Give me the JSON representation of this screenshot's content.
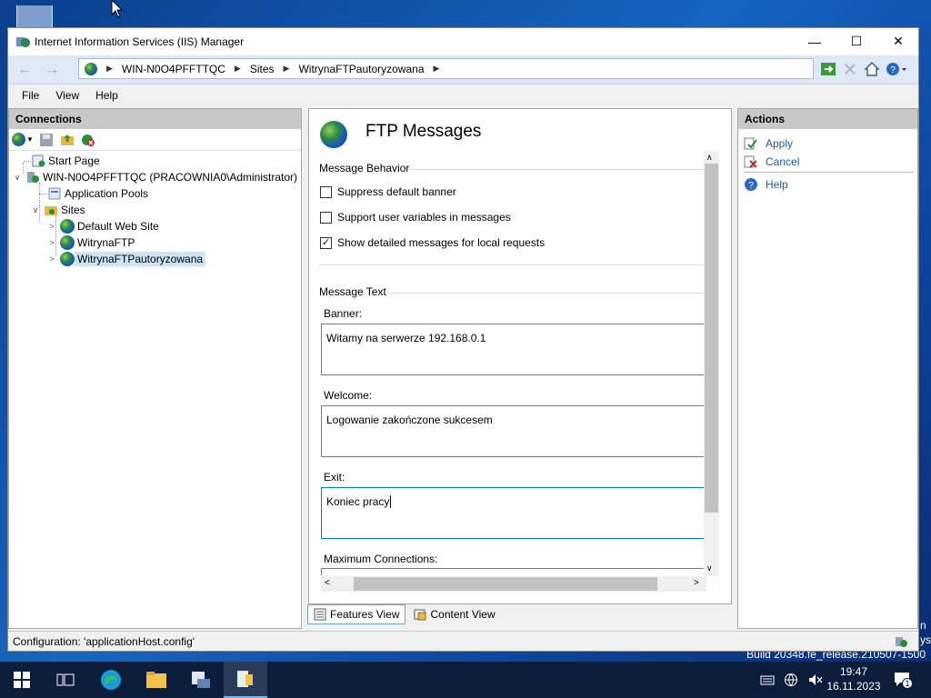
{
  "desktop": {
    "build_text": "Build 20348.fe_release.210507-1500",
    "edge_text_1": "n",
    "edge_text_2": "ys"
  },
  "window": {
    "title": "Internet Information Services (IIS) Manager",
    "controls": {
      "minimize": "—",
      "maximize": "☐",
      "close": "✕"
    }
  },
  "address": {
    "crumbs": [
      "WIN-N0O4PFFTTQC",
      "Sites",
      "WitrynaFTPautoryzowana"
    ]
  },
  "menu": [
    "File",
    "View",
    "Help"
  ],
  "connections": {
    "title": "Connections",
    "tree": [
      {
        "label": "Start Page"
      },
      {
        "label": "WIN-N0O4PFFTTQC (PRACOWNIA0\\Administrator)"
      },
      {
        "label": "Application Pools"
      },
      {
        "label": "Sites"
      },
      {
        "label": "Default Web Site"
      },
      {
        "label": "WitrynaFTP"
      },
      {
        "label": "WitrynaFTPautoryzowana"
      }
    ]
  },
  "feature": {
    "title": "FTP Messages",
    "behavior_label": "Message Behavior",
    "checkboxes": [
      {
        "label": "Suppress default banner",
        "checked": false
      },
      {
        "label": "Support user variables in messages",
        "checked": false
      },
      {
        "label": "Show detailed messages for local requests",
        "checked": true
      }
    ],
    "text_label": "Message Text",
    "fields": [
      {
        "label": "Banner:",
        "value": "Witamy na serwerze 192.168.0.1"
      },
      {
        "label": "Welcome:",
        "value": "Logowanie zakończone sukcesem"
      },
      {
        "label": "Exit:",
        "value": "Koniec pracy"
      }
    ],
    "max_conn_label": "Maximum Connections:"
  },
  "view_tabs": [
    "Features View",
    "Content View"
  ],
  "actions": {
    "title": "Actions",
    "items": [
      "Apply",
      "Cancel",
      "Help"
    ]
  },
  "status": "Configuration: 'applicationHost.config'",
  "clock": {
    "time": "19:47",
    "date": "16.11.2023"
  },
  "notification_count": "1"
}
